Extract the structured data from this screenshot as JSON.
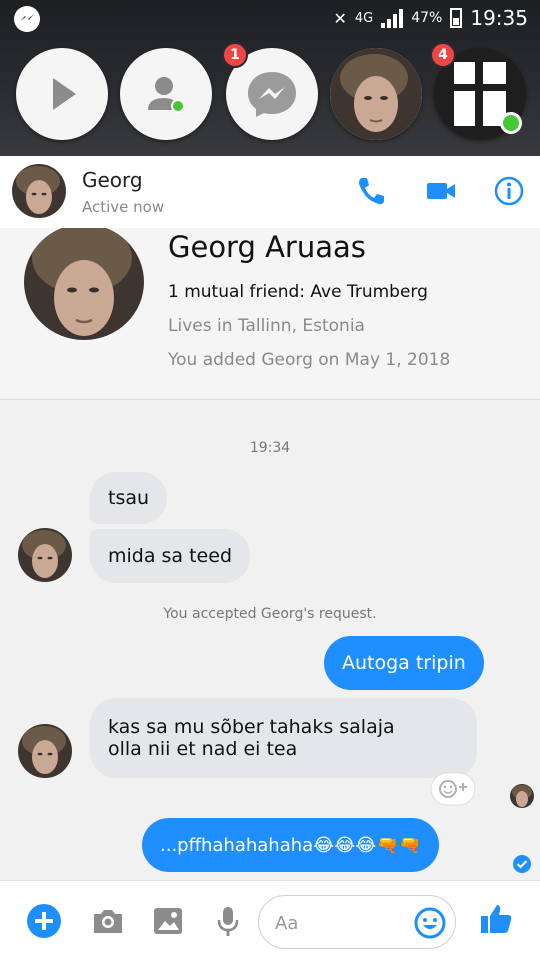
{
  "status_bar": {
    "network": "4G",
    "battery": "47%",
    "time": "19:35"
  },
  "chat_heads": [
    {
      "id": "play",
      "badge": ""
    },
    {
      "id": "contacts",
      "badge": ""
    },
    {
      "id": "messenger",
      "badge": "1"
    },
    {
      "id": "georg",
      "badge": ""
    },
    {
      "id": "group",
      "badge": "4"
    }
  ],
  "header": {
    "name": "Georg",
    "status": "Active now"
  },
  "profile": {
    "full_name": "Georg Aruaas",
    "mutual": "1 mutual friend: Ave Trumberg",
    "lives": "Lives in Tallinn, Estonia",
    "added": "You added Georg on May 1, 2018"
  },
  "messages": {
    "timestamp": "19:34",
    "m1": "tsau",
    "m2": "mida sa teed",
    "system": "You accepted Georg's request.",
    "m3": "Autoga tripin",
    "m4_line1": "kas sa mu sõber tahaks salaja",
    "m4_line2": "olla nii et nad ei tea",
    "m5": "...pffhahahahaha😂😂😂🔫🔫"
  },
  "composer": {
    "placeholder": "Aa"
  },
  "colors": {
    "accent": "#1f8fff",
    "active": "#42c934",
    "badge": "#f04545"
  }
}
